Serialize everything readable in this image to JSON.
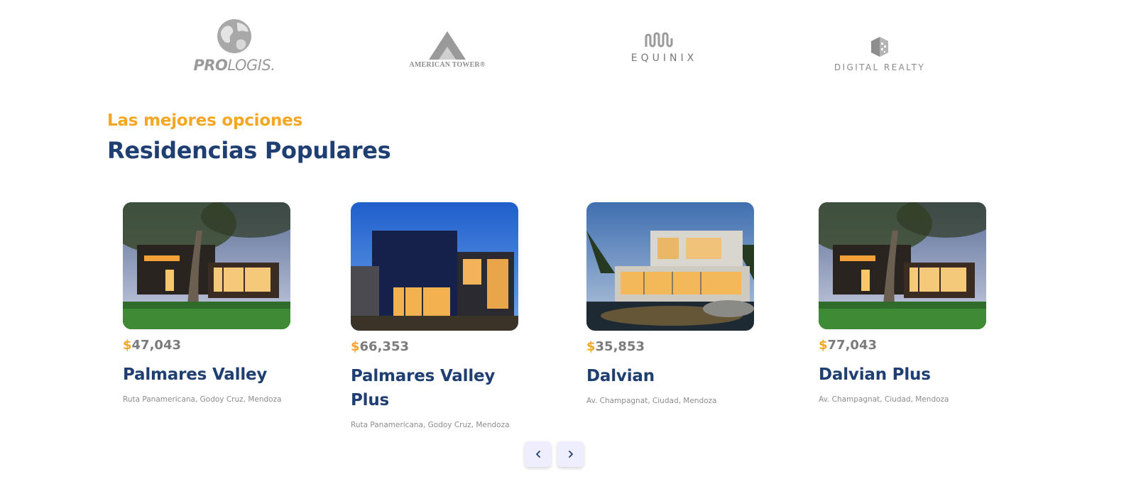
{
  "partners": {
    "prologis": {
      "bold": "PRO",
      "light": "LOGIS."
    },
    "american_tower": {
      "name": "AMERICAN TOWER®"
    },
    "equinix": {
      "name": "EQUINIX"
    },
    "digital_realty": {
      "name": "DIGITAL REALTY"
    },
    "logo_color": "#8a8a8a"
  },
  "section": {
    "kicker": "Las mejores opciones",
    "title": "Residencias Populares"
  },
  "colors": {
    "accent": "#f5a623",
    "title": "#1f3e72",
    "price": "#7b7b7b",
    "address": "#8c8c8c",
    "nav_bg": "#eeeeff"
  },
  "residences": [
    {
      "currency": "$",
      "price": "47,043",
      "name": "Palmares Valley",
      "address": "Ruta Panamericana, Godoy Cruz, Mendoza",
      "image": "house-tree-lawn"
    },
    {
      "currency": "$",
      "price": "66,353",
      "name": "Palmares Valley Plus",
      "address": "Ruta Panamericana, Godoy Cruz, Mendoza",
      "image": "house-dusk-blue"
    },
    {
      "currency": "$",
      "price": "35,853",
      "name": "Dalvian",
      "address": "Av. Champagnat, Ciudad, Mendoza",
      "image": "house-pool-evening"
    },
    {
      "currency": "$",
      "price": "77,043",
      "name": "Dalvian Plus",
      "address": "Av. Champagnat, Ciudad, Mendoza",
      "image": "house-tree-lawn"
    }
  ],
  "carousel": {
    "prev_icon": "chevron-left-icon",
    "next_icon": "chevron-right-icon"
  }
}
